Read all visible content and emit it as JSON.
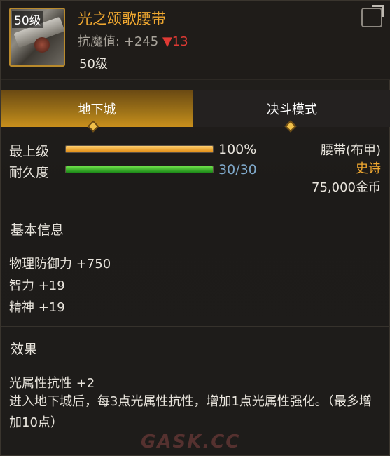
{
  "header": {
    "level_badge": "50级",
    "item_name": "光之颂歌腰带",
    "stat_label": "抗魔值: +245",
    "stat_delta": "▼13",
    "item_level": "50级"
  },
  "tabs": [
    {
      "label": "地下城",
      "active": true
    },
    {
      "label": "决斗模式",
      "active": false
    }
  ],
  "stats": {
    "grade_label": "最上级",
    "grade_value": "100%",
    "grade_fraction": 1.0,
    "durability_label": "耐久度",
    "durability_value": "30/30",
    "durability_fraction": 1.0
  },
  "info": {
    "type": "腰带(布甲)",
    "rarity": "史诗",
    "price": "75,000金币"
  },
  "basic": {
    "title": "基本信息",
    "lines": [
      "物理防御力 +750",
      "智力 +19",
      "精神 +19"
    ]
  },
  "effect": {
    "title": "效果",
    "line1": "光属性抗性 +2",
    "description": "进入地下城后，每3点光属性抗性，增加1点光属性强化。（最多增加10点）"
  },
  "watermark": "GASK.CC",
  "colors": {
    "accent": "#f0a830",
    "delta": "#e03a34",
    "durability": "#7fa8c9"
  }
}
